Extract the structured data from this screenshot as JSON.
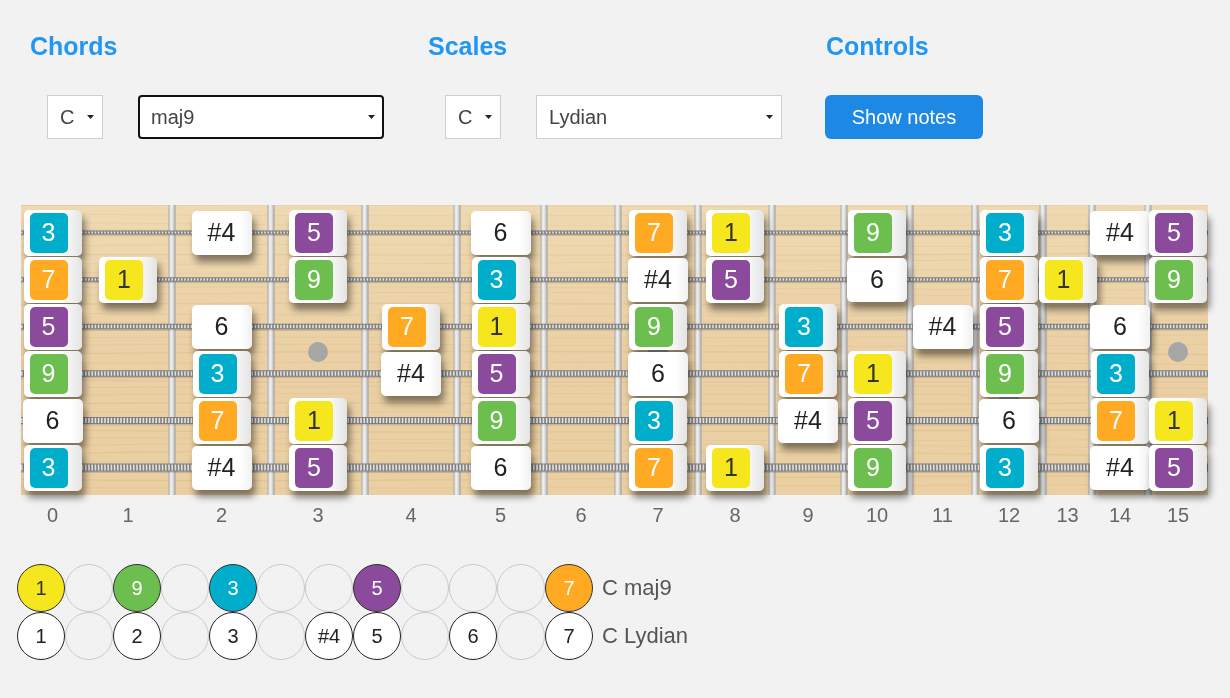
{
  "panels": [
    {
      "title": "Chords",
      "selects": [
        {
          "kind": "root",
          "value": "C",
          "focused": false
        },
        {
          "kind": "type",
          "value": "maj9",
          "focused": true
        }
      ]
    },
    {
      "title": "Scales",
      "selects": [
        {
          "kind": "root",
          "value": "C",
          "focused": false
        },
        {
          "kind": "type",
          "value": "Lydian",
          "focused": false
        }
      ]
    },
    {
      "title": "Controls",
      "buttons": [
        "Show notes"
      ]
    }
  ],
  "fretboard": {
    "strings": [
      {
        "frets": [
          {
            "kind": "chord",
            "label": "3",
            "color": "#00aecb"
          },
          {
            "kind": "none"
          },
          {
            "kind": "scale",
            "label": "#4"
          },
          {
            "kind": "chord",
            "label": "5",
            "color": "#8c4a9c"
          },
          {
            "kind": "none"
          },
          {
            "kind": "scale",
            "label": "6"
          },
          {
            "kind": "none"
          },
          {
            "kind": "chord",
            "label": "7",
            "color": "#ffaa22"
          },
          {
            "kind": "chord",
            "label": "1",
            "color": "#f5e61e"
          },
          {
            "kind": "none"
          },
          {
            "kind": "chord",
            "label": "9",
            "color": "#6cbf4e"
          },
          {
            "kind": "none"
          },
          {
            "kind": "chord",
            "label": "3",
            "color": "#00aecb"
          },
          {
            "kind": "none"
          },
          {
            "kind": "scale",
            "label": "#4"
          },
          {
            "kind": "chord",
            "label": "5",
            "color": "#8c4a9c"
          }
        ]
      },
      {
        "frets": [
          {
            "kind": "chord",
            "label": "7",
            "color": "#ffaa22"
          },
          {
            "kind": "chord",
            "label": "1",
            "color": "#f5e61e"
          },
          {
            "kind": "none"
          },
          {
            "kind": "chord",
            "label": "9",
            "color": "#6cbf4e"
          },
          {
            "kind": "none"
          },
          {
            "kind": "chord",
            "label": "3",
            "color": "#00aecb"
          },
          {
            "kind": "none"
          },
          {
            "kind": "scale",
            "label": "#4"
          },
          {
            "kind": "chord",
            "label": "5",
            "color": "#8c4a9c"
          },
          {
            "kind": "none"
          },
          {
            "kind": "scale",
            "label": "6"
          },
          {
            "kind": "none"
          },
          {
            "kind": "chord",
            "label": "7",
            "color": "#ffaa22"
          },
          {
            "kind": "chord",
            "label": "1",
            "color": "#f5e61e"
          },
          {
            "kind": "none"
          },
          {
            "kind": "chord",
            "label": "9",
            "color": "#6cbf4e"
          }
        ]
      },
      {
        "frets": [
          {
            "kind": "chord",
            "label": "5",
            "color": "#8c4a9c"
          },
          {
            "kind": "none"
          },
          {
            "kind": "scale",
            "label": "6"
          },
          {
            "kind": "none"
          },
          {
            "kind": "chord",
            "label": "7",
            "color": "#ffaa22"
          },
          {
            "kind": "chord",
            "label": "1",
            "color": "#f5e61e"
          },
          {
            "kind": "none"
          },
          {
            "kind": "chord",
            "label": "9",
            "color": "#6cbf4e"
          },
          {
            "kind": "none"
          },
          {
            "kind": "chord",
            "label": "3",
            "color": "#00aecb"
          },
          {
            "kind": "none"
          },
          {
            "kind": "scale",
            "label": "#4"
          },
          {
            "kind": "chord",
            "label": "5",
            "color": "#8c4a9c"
          },
          {
            "kind": "none"
          },
          {
            "kind": "scale",
            "label": "6"
          },
          {
            "kind": "none"
          }
        ]
      },
      {
        "frets": [
          {
            "kind": "chord",
            "label": "9",
            "color": "#6cbf4e"
          },
          {
            "kind": "none"
          },
          {
            "kind": "chord",
            "label": "3",
            "color": "#00aecb"
          },
          {
            "kind": "none"
          },
          {
            "kind": "scale",
            "label": "#4"
          },
          {
            "kind": "chord",
            "label": "5",
            "color": "#8c4a9c"
          },
          {
            "kind": "none"
          },
          {
            "kind": "scale",
            "label": "6"
          },
          {
            "kind": "none"
          },
          {
            "kind": "chord",
            "label": "7",
            "color": "#ffaa22"
          },
          {
            "kind": "chord",
            "label": "1",
            "color": "#f5e61e"
          },
          {
            "kind": "none"
          },
          {
            "kind": "chord",
            "label": "9",
            "color": "#6cbf4e"
          },
          {
            "kind": "none"
          },
          {
            "kind": "chord",
            "label": "3",
            "color": "#00aecb"
          },
          {
            "kind": "none"
          }
        ]
      },
      {
        "frets": [
          {
            "kind": "scale",
            "label": "6"
          },
          {
            "kind": "none"
          },
          {
            "kind": "chord",
            "label": "7",
            "color": "#ffaa22"
          },
          {
            "kind": "chord",
            "label": "1",
            "color": "#f5e61e"
          },
          {
            "kind": "none"
          },
          {
            "kind": "chord",
            "label": "9",
            "color": "#6cbf4e"
          },
          {
            "kind": "none"
          },
          {
            "kind": "chord",
            "label": "3",
            "color": "#00aecb"
          },
          {
            "kind": "none"
          },
          {
            "kind": "scale",
            "label": "#4"
          },
          {
            "kind": "chord",
            "label": "5",
            "color": "#8c4a9c"
          },
          {
            "kind": "none"
          },
          {
            "kind": "scale",
            "label": "6"
          },
          {
            "kind": "none"
          },
          {
            "kind": "chord",
            "label": "7",
            "color": "#ffaa22"
          },
          {
            "kind": "chord",
            "label": "1",
            "color": "#f5e61e"
          }
        ]
      },
      {
        "frets": [
          {
            "kind": "chord",
            "label": "3",
            "color": "#00aecb"
          },
          {
            "kind": "none"
          },
          {
            "kind": "scale",
            "label": "#4"
          },
          {
            "kind": "chord",
            "label": "5",
            "color": "#8c4a9c"
          },
          {
            "kind": "none"
          },
          {
            "kind": "scale",
            "label": "6"
          },
          {
            "kind": "none"
          },
          {
            "kind": "chord",
            "label": "7",
            "color": "#ffaa22"
          },
          {
            "kind": "chord",
            "label": "1",
            "color": "#f5e61e"
          },
          {
            "kind": "none"
          },
          {
            "kind": "chord",
            "label": "9",
            "color": "#6cbf4e"
          },
          {
            "kind": "none"
          },
          {
            "kind": "chord",
            "label": "3",
            "color": "#00aecb"
          },
          {
            "kind": "none"
          },
          {
            "kind": "scale",
            "label": "#4"
          },
          {
            "kind": "chord",
            "label": "5",
            "color": "#8c4a9c"
          }
        ]
      }
    ],
    "fret_numbers": [
      "0",
      "1",
      "2",
      "3",
      "4",
      "5",
      "6",
      "7",
      "8",
      "9",
      "10",
      "11",
      "12",
      "13",
      "14",
      "15"
    ]
  },
  "intervals": [
    {
      "label": "C maj9",
      "slots": [
        {
          "kind": "chord",
          "label": "1",
          "color": "#f5e61e"
        },
        {
          "kind": "empty"
        },
        {
          "kind": "chord",
          "label": "9",
          "color": "#6cbf4e"
        },
        {
          "kind": "empty"
        },
        {
          "kind": "chord",
          "label": "3",
          "color": "#00aecb"
        },
        {
          "kind": "empty"
        },
        {
          "kind": "empty"
        },
        {
          "kind": "chord",
          "label": "5",
          "color": "#8c4a9c"
        },
        {
          "kind": "empty"
        },
        {
          "kind": "empty"
        },
        {
          "kind": "empty"
        },
        {
          "kind": "chord",
          "label": "7",
          "color": "#ffaa22"
        }
      ]
    },
    {
      "label": "C Lydian",
      "slots": [
        {
          "kind": "scale",
          "label": "1"
        },
        {
          "kind": "empty"
        },
        {
          "kind": "scale",
          "label": "2"
        },
        {
          "kind": "empty"
        },
        {
          "kind": "scale",
          "label": "3"
        },
        {
          "kind": "empty"
        },
        {
          "kind": "scale",
          "label": "#4"
        },
        {
          "kind": "scale",
          "label": "5"
        },
        {
          "kind": "empty"
        },
        {
          "kind": "scale",
          "label": "6"
        },
        {
          "kind": "empty"
        },
        {
          "kind": "scale",
          "label": "7"
        }
      ]
    }
  ]
}
